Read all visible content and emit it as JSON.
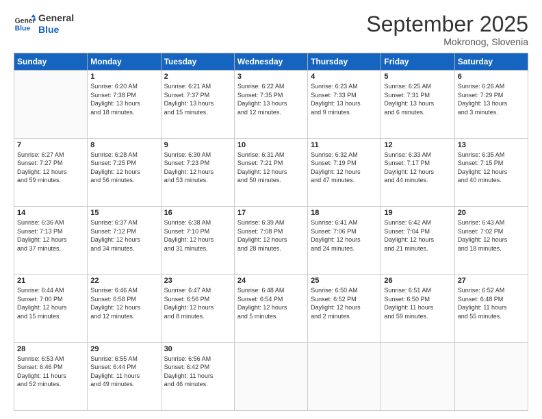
{
  "logo": {
    "line1": "General",
    "line2": "Blue"
  },
  "title": "September 2025",
  "location": "Mokronog, Slovenia",
  "days_header": [
    "Sunday",
    "Monday",
    "Tuesday",
    "Wednesday",
    "Thursday",
    "Friday",
    "Saturday"
  ],
  "weeks": [
    [
      {
        "day": "",
        "info": ""
      },
      {
        "day": "1",
        "info": "Sunrise: 6:20 AM\nSunset: 7:38 PM\nDaylight: 13 hours\nand 18 minutes."
      },
      {
        "day": "2",
        "info": "Sunrise: 6:21 AM\nSunset: 7:37 PM\nDaylight: 13 hours\nand 15 minutes."
      },
      {
        "day": "3",
        "info": "Sunrise: 6:22 AM\nSunset: 7:35 PM\nDaylight: 13 hours\nand 12 minutes."
      },
      {
        "day": "4",
        "info": "Sunrise: 6:23 AM\nSunset: 7:33 PM\nDaylight: 13 hours\nand 9 minutes."
      },
      {
        "day": "5",
        "info": "Sunrise: 6:25 AM\nSunset: 7:31 PM\nDaylight: 13 hours\nand 6 minutes."
      },
      {
        "day": "6",
        "info": "Sunrise: 6:26 AM\nSunset: 7:29 PM\nDaylight: 13 hours\nand 3 minutes."
      }
    ],
    [
      {
        "day": "7",
        "info": "Sunrise: 6:27 AM\nSunset: 7:27 PM\nDaylight: 12 hours\nand 59 minutes."
      },
      {
        "day": "8",
        "info": "Sunrise: 6:28 AM\nSunset: 7:25 PM\nDaylight: 12 hours\nand 56 minutes."
      },
      {
        "day": "9",
        "info": "Sunrise: 6:30 AM\nSunset: 7:23 PM\nDaylight: 12 hours\nand 53 minutes."
      },
      {
        "day": "10",
        "info": "Sunrise: 6:31 AM\nSunset: 7:21 PM\nDaylight: 12 hours\nand 50 minutes."
      },
      {
        "day": "11",
        "info": "Sunrise: 6:32 AM\nSunset: 7:19 PM\nDaylight: 12 hours\nand 47 minutes."
      },
      {
        "day": "12",
        "info": "Sunrise: 6:33 AM\nSunset: 7:17 PM\nDaylight: 12 hours\nand 44 minutes."
      },
      {
        "day": "13",
        "info": "Sunrise: 6:35 AM\nSunset: 7:15 PM\nDaylight: 12 hours\nand 40 minutes."
      }
    ],
    [
      {
        "day": "14",
        "info": "Sunrise: 6:36 AM\nSunset: 7:13 PM\nDaylight: 12 hours\nand 37 minutes."
      },
      {
        "day": "15",
        "info": "Sunrise: 6:37 AM\nSunset: 7:12 PM\nDaylight: 12 hours\nand 34 minutes."
      },
      {
        "day": "16",
        "info": "Sunrise: 6:38 AM\nSunset: 7:10 PM\nDaylight: 12 hours\nand 31 minutes."
      },
      {
        "day": "17",
        "info": "Sunrise: 6:39 AM\nSunset: 7:08 PM\nDaylight: 12 hours\nand 28 minutes."
      },
      {
        "day": "18",
        "info": "Sunrise: 6:41 AM\nSunset: 7:06 PM\nDaylight: 12 hours\nand 24 minutes."
      },
      {
        "day": "19",
        "info": "Sunrise: 6:42 AM\nSunset: 7:04 PM\nDaylight: 12 hours\nand 21 minutes."
      },
      {
        "day": "20",
        "info": "Sunrise: 6:43 AM\nSunset: 7:02 PM\nDaylight: 12 hours\nand 18 minutes."
      }
    ],
    [
      {
        "day": "21",
        "info": "Sunrise: 6:44 AM\nSunset: 7:00 PM\nDaylight: 12 hours\nand 15 minutes."
      },
      {
        "day": "22",
        "info": "Sunrise: 6:46 AM\nSunset: 6:58 PM\nDaylight: 12 hours\nand 12 minutes."
      },
      {
        "day": "23",
        "info": "Sunrise: 6:47 AM\nSunset: 6:56 PM\nDaylight: 12 hours\nand 8 minutes."
      },
      {
        "day": "24",
        "info": "Sunrise: 6:48 AM\nSunset: 6:54 PM\nDaylight: 12 hours\nand 5 minutes."
      },
      {
        "day": "25",
        "info": "Sunrise: 6:50 AM\nSunset: 6:52 PM\nDaylight: 12 hours\nand 2 minutes."
      },
      {
        "day": "26",
        "info": "Sunrise: 6:51 AM\nSunset: 6:50 PM\nDaylight: 11 hours\nand 59 minutes."
      },
      {
        "day": "27",
        "info": "Sunrise: 6:52 AM\nSunset: 6:48 PM\nDaylight: 11 hours\nand 55 minutes."
      }
    ],
    [
      {
        "day": "28",
        "info": "Sunrise: 6:53 AM\nSunset: 6:46 PM\nDaylight: 11 hours\nand 52 minutes."
      },
      {
        "day": "29",
        "info": "Sunrise: 6:55 AM\nSunset: 6:44 PM\nDaylight: 11 hours\nand 49 minutes."
      },
      {
        "day": "30",
        "info": "Sunrise: 6:56 AM\nSunset: 6:42 PM\nDaylight: 11 hours\nand 46 minutes."
      },
      {
        "day": "",
        "info": ""
      },
      {
        "day": "",
        "info": ""
      },
      {
        "day": "",
        "info": ""
      },
      {
        "day": "",
        "info": ""
      }
    ]
  ]
}
